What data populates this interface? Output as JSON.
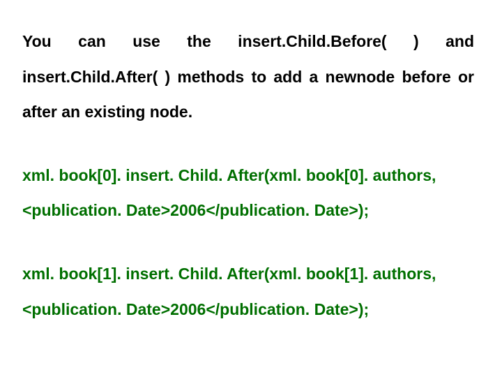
{
  "para1_parts": {
    "a": "You can use the insert.Child.Before( ) and insert.Child.After( ) methods to add a newnode before or after an existing node."
  },
  "code1": {
    "line1": "xml. book[0]. insert. Child. After(xml. book[0]. authors,",
    "line2": "<publication. Date>2006</publication. Date>);"
  },
  "code2": {
    "line1": "xml. book[1]. insert. Child. After(xml. book[1]. authors,",
    "line2": "<publication. Date>2006</publication. Date>);"
  }
}
